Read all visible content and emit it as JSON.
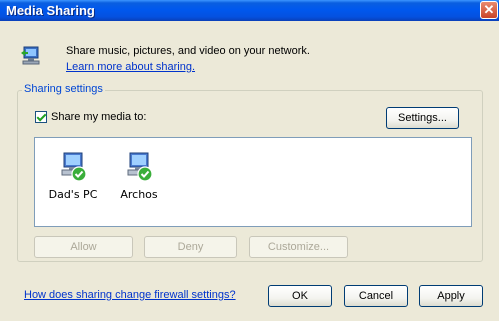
{
  "window": {
    "title": "Media Sharing",
    "close_label": "✕"
  },
  "intro": {
    "text": "Share music, pictures, and video on your network.",
    "learn_more": "Learn more about sharing."
  },
  "sharing_settings": {
    "label": "Sharing settings",
    "share_checkbox_label": "Share my media to:",
    "share_checked": true,
    "settings_button": "Settings...",
    "devices": [
      {
        "label": "Dad's PC",
        "icon": "computer-shared-icon"
      },
      {
        "label": "Archos",
        "icon": "computer-shared-icon"
      }
    ],
    "allow_button": "Allow",
    "deny_button": "Deny",
    "customize_button": "Customize..."
  },
  "footer": {
    "firewall_link": "How does sharing change firewall settings?",
    "ok_button": "OK",
    "cancel_button": "Cancel",
    "apply_button": "Apply"
  },
  "colors": {
    "titlebar": "#0058ee",
    "window_bg": "#ece9d8",
    "link": "#0033cc",
    "group_label": "#0046d5"
  }
}
